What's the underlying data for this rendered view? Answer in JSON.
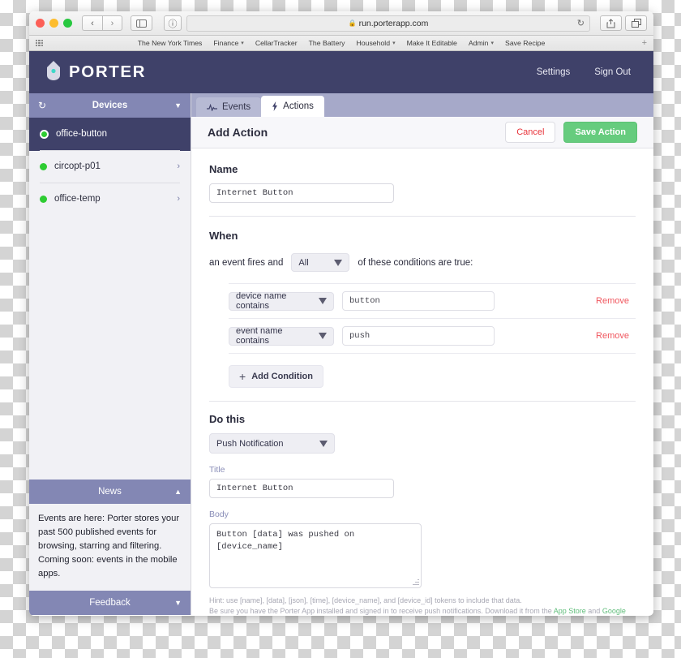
{
  "browser": {
    "url": "run.porterapp.com",
    "lock_icon": "lock-icon",
    "reload_icon": "reload-icon",
    "back_icon": "chevron-left-icon",
    "forward_icon": "chevron-right-icon",
    "sidebar_icon": "sidebar-toggle-icon",
    "info_icon": "info-icon",
    "share_icon": "share-icon",
    "tabs_icon": "show-tabs-icon",
    "apps_grid_icon": "apps-grid-icon",
    "add_bookmark_label": "+",
    "bookmarks": [
      {
        "label": "The New York Times",
        "has_menu": false
      },
      {
        "label": "Finance",
        "has_menu": true
      },
      {
        "label": "CellarTracker",
        "has_menu": false
      },
      {
        "label": "The Battery",
        "has_menu": false
      },
      {
        "label": "Household",
        "has_menu": true
      },
      {
        "label": "Make It Editable",
        "has_menu": false
      },
      {
        "label": "Admin",
        "has_menu": true
      },
      {
        "label": "Save Recipe",
        "has_menu": false
      }
    ]
  },
  "app_header": {
    "brand": "PORTER",
    "logo_icon": "porter-tag-logo",
    "nav": [
      {
        "label": "Settings"
      },
      {
        "label": "Sign Out"
      }
    ]
  },
  "sidebar": {
    "devices_header": {
      "title": "Devices",
      "refresh_icon": "refresh-icon",
      "collapse_icon": "chevron-down-icon"
    },
    "devices": [
      {
        "name": "office-button",
        "status": "online",
        "active": true,
        "chevron": ""
      },
      {
        "name": "circopt-p01",
        "status": "online",
        "active": false,
        "chevron": "›"
      },
      {
        "name": "office-temp",
        "status": "online",
        "active": false,
        "chevron": "›"
      }
    ],
    "news": {
      "title": "News",
      "collapse_icon": "chevron-up-icon",
      "text": "Events are here: Porter stores your past 500 published events for browsing, starring and filtering. Coming soon: events in the mobile apps."
    },
    "feedback": {
      "title": "Feedback",
      "collapse_icon": "chevron-down-icon"
    }
  },
  "main": {
    "tabs": [
      {
        "label": "Events",
        "icon": "activity-pulse-icon",
        "active": false
      },
      {
        "label": "Actions",
        "icon": "lightning-bolt-icon",
        "active": true
      }
    ],
    "action_bar": {
      "title": "Add Action",
      "cancel_label": "Cancel",
      "save_label": "Save Action"
    },
    "name_section": {
      "title": "Name",
      "value": "Internet Button"
    },
    "when_section": {
      "title": "When",
      "prefix_text": "an event fires and",
      "match_value": "All",
      "suffix_text": "of these conditions are true:",
      "conditions": [
        {
          "type": "device name contains",
          "value": "button",
          "remove_label": "Remove"
        },
        {
          "type": "event name contains",
          "value": "push",
          "remove_label": "Remove"
        }
      ],
      "add_condition_label": "Add Condition",
      "add_condition_icon": "plus-icon"
    },
    "do_section": {
      "title": "Do this",
      "action_type": "Push Notification",
      "title_label": "Title",
      "title_value": "Internet Button",
      "body_label": "Body",
      "body_value": "Button [data] was pushed on [device_name]",
      "hint_line_1": "Hint: use [name], [data], [json], [time], [device_name], and [device_id] tokens to include that data.",
      "hint_line_2_a": "Be sure you have the Porter App installed and signed in to receive push notifications. Download it from the ",
      "hint_link_1": "App Store",
      "hint_line_2_b": " and ",
      "hint_link_2": "Google Play",
      "hint_line_2_c": "."
    }
  },
  "colors": {
    "brand_dark": "#3f4169",
    "brand_mid": "#8387b4",
    "tab_strip": "#a6a9c9",
    "success_green": "#66cc7e",
    "danger_red": "#f0565e",
    "status_online": "#2ecc32",
    "link_green": "#5fbd7a",
    "field_label": "#8a8eb8"
  }
}
